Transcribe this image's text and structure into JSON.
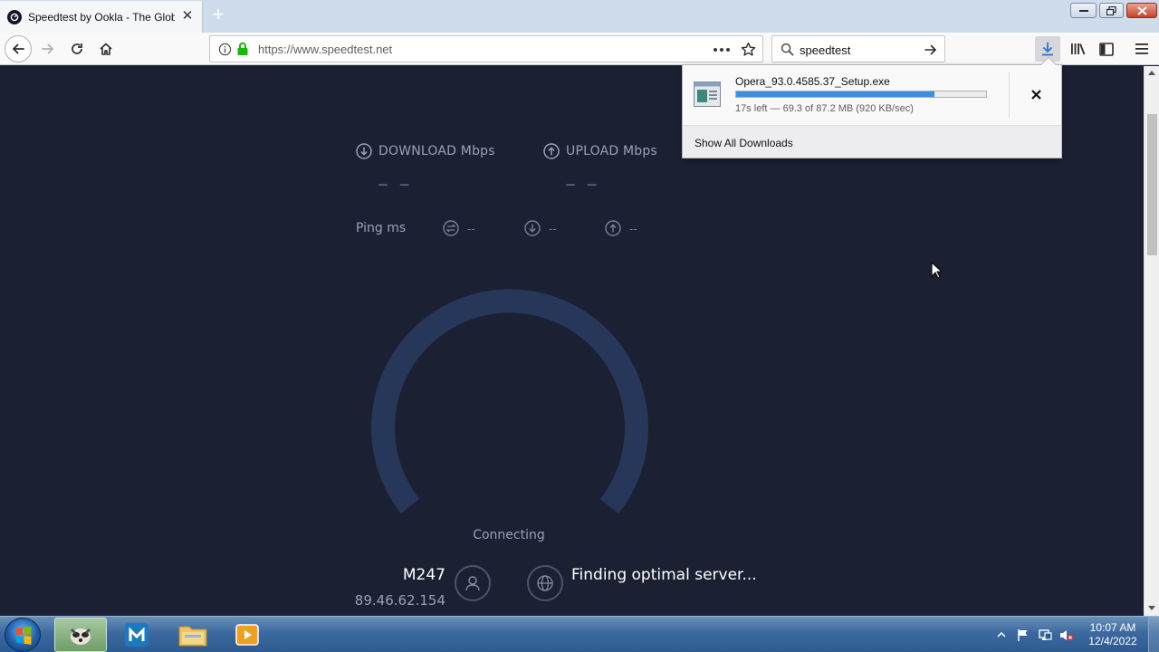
{
  "browser": {
    "tab": {
      "title": "Speedtest by Ookla - The Global Broadband Speed Test"
    },
    "address": {
      "url": "https://www.speedtest.net"
    },
    "search": {
      "value": "speedtest"
    }
  },
  "downloads": {
    "file_name": "Opera_93.0.4585.37_Setup.exe",
    "status": "17s left — 69.3 of 87.2 MB (920 KB/sec)",
    "progress_fraction": 0.795,
    "show_all_label": "Show All Downloads"
  },
  "speedtest": {
    "download_label": "DOWNLOAD Mbps",
    "upload_label": "UPLOAD Mbps",
    "download_value": "– –",
    "upload_value": "– –",
    "ping_label": "Ping ms",
    "jitter_value": "--",
    "ping_down_value": "--",
    "ping_up_value": "--",
    "status": "Connecting",
    "isp_name": "M247",
    "isp_ip": "89.46.62.154",
    "server_status": "Finding optimal server..."
  },
  "taskbar": {
    "time": "10:07 AM",
    "date": "12/4/2022"
  },
  "colors": {
    "page_bg": "#1c2033",
    "gauge_track": "#27375a",
    "download_progress": "#3b8fe0"
  }
}
